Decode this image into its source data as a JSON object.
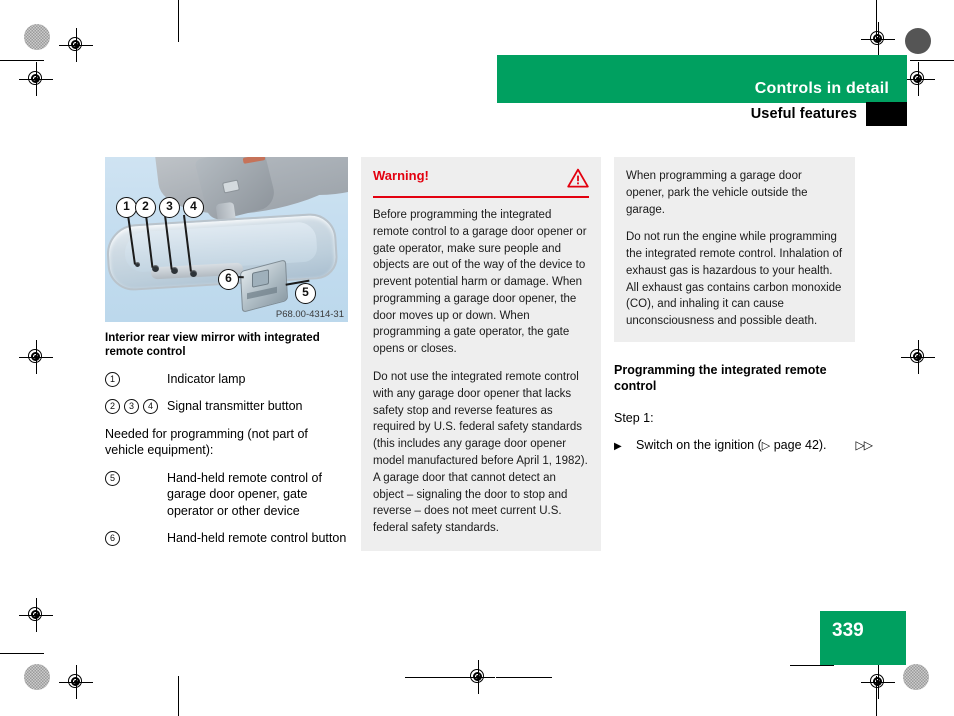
{
  "header": {
    "title": "Controls in detail",
    "subtitle": "Useful features"
  },
  "figure": {
    "code": "P68.00-4314-31",
    "callouts": [
      "1",
      "2",
      "3",
      "4",
      "5",
      "6"
    ],
    "caption": "Interior rear view mirror with integrated remote control"
  },
  "legend": {
    "rows": [
      {
        "keys": [
          "1"
        ],
        "text": "Indicator lamp"
      },
      {
        "keys": [
          "2",
          "3",
          "4"
        ],
        "text": "Signal transmitter button"
      }
    ],
    "note": "Needed for programming (not part of vehicle equipment):",
    "rows2": [
      {
        "keys": [
          "5"
        ],
        "text": "Hand-held remote control of garage door opener, gate operator or other device"
      },
      {
        "keys": [
          "6"
        ],
        "text": "Hand-held remote control button"
      }
    ]
  },
  "warning": {
    "title": "Warning!",
    "icon": "warning-triangle-icon",
    "paragraphs": [
      "Before programming the integrated remote control to a garage door opener or gate operator, make sure people and objects are out of the way of the device to prevent potential harm or damage. When programming a garage door opener, the door moves up or down. When programming a gate operator, the gate opens or closes.",
      "Do not use the integrated remote control with any garage door opener that lacks safety stop and reverse features as required by U.S. federal safety standards (this includes any garage door opener model manufactured before April 1, 1982). A garage door that cannot detect an object – signaling the door to stop and reverse – does not meet current U.S. federal safety standards."
    ],
    "accent_color": "#e3000f"
  },
  "note": {
    "paragraphs": [
      "When programming a garage door opener, park the vehicle outside the garage.",
      "Do not run the engine while programming the integrated remote control. Inhalation of exhaust gas is hazardous to your health. All exhaust gas contains carbon monoxide (CO), and inhaling it can cause unconsciousness and possible death."
    ]
  },
  "section": {
    "heading": "Programming the integrated remote control",
    "step_label": "Step 1:",
    "step": {
      "bullet": "▶",
      "text_before": "Switch on the ignition (",
      "ref_arrow": "▷",
      "ref_text": " page 42).",
      "continuation": "▷▷"
    }
  },
  "footer": {
    "page_number": "339"
  },
  "colors": {
    "brand_green": "#00a060",
    "warning_red": "#e3000f",
    "box_gray": "#eeeeee"
  }
}
